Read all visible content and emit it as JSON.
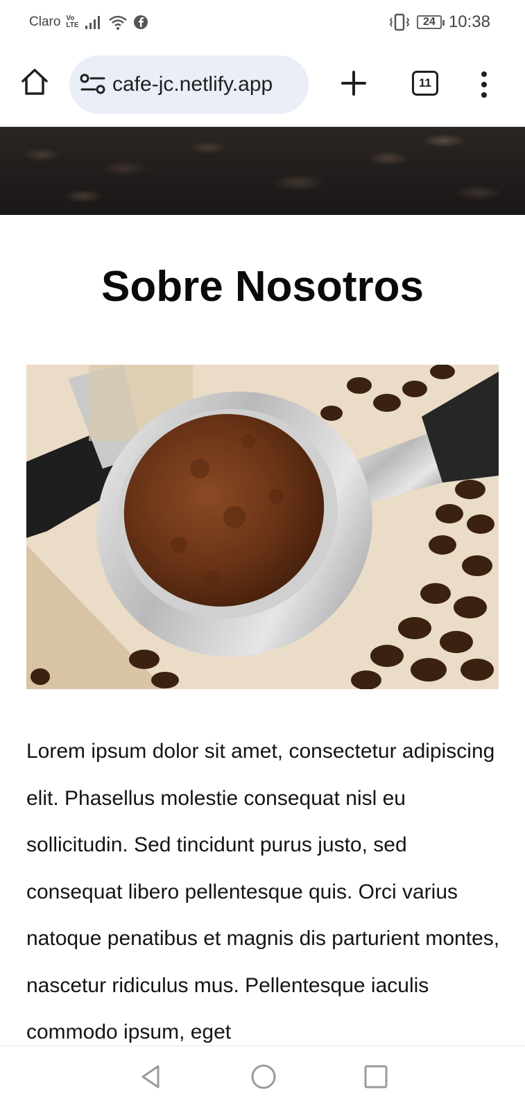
{
  "status_bar": {
    "carrier": "Claro",
    "volte_top": "Vo",
    "volte_bottom": "LTE",
    "battery_level": "24",
    "time": "10:38",
    "icons": [
      "signal-icon",
      "wifi-icon",
      "facebook-icon",
      "vibrate-icon",
      "battery-icon"
    ]
  },
  "browser": {
    "url": "cafe-jc.netlify.app",
    "tab_count": "11",
    "icons": [
      "home-icon",
      "site-settings-icon",
      "new-tab-icon",
      "tabs-icon",
      "more-menu-icon"
    ]
  },
  "page": {
    "title": "Sobre Nosotros",
    "paragraph": "Lorem ipsum dolor sit amet, consectetur adipiscing elit. Phasellus molestie consequat nisl eu sollicitudin. Sed tincidunt purus justo, sed consequat libero pellentesque quis. Orci varius natoque penatibus et magnis dis parturient montes, nascetur ridiculus mus. Pellentesque iaculis commodo ipsum, eget"
  },
  "nav_bar": {
    "icons": [
      "back-icon",
      "home-circle-icon",
      "recents-icon"
    ]
  },
  "colors": {
    "url_bar_bg": "#e9eef7",
    "text": "#141414",
    "hero_dark": "#1f1c1b"
  }
}
